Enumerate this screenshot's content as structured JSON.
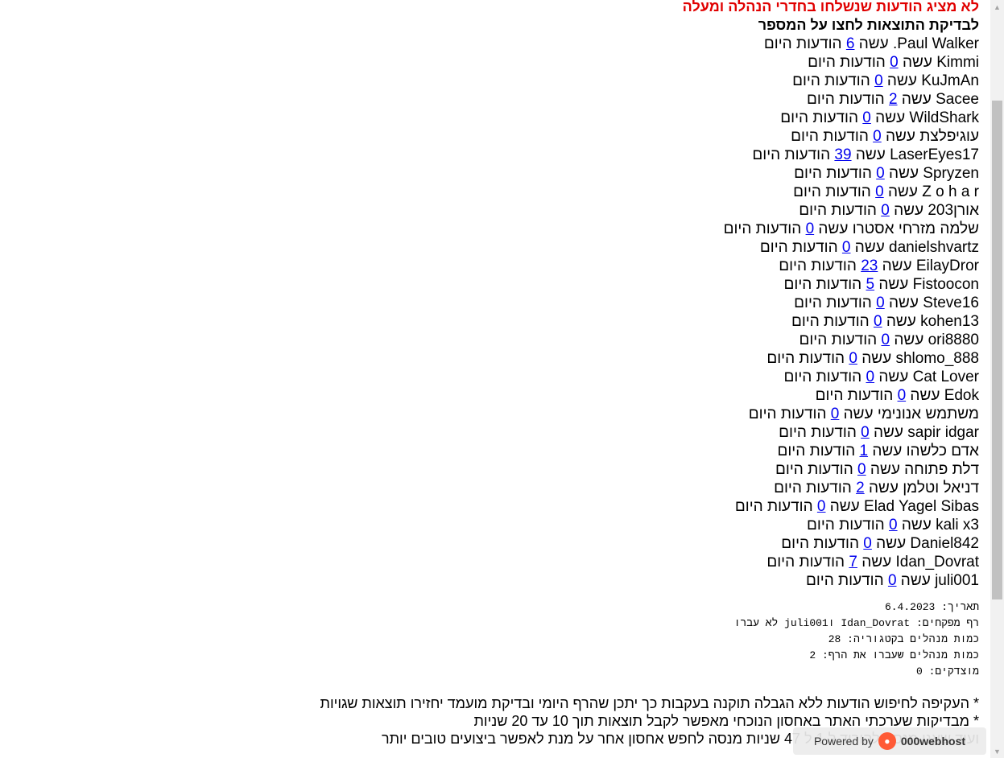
{
  "warning": "לא מציג הודעות שנשלחו בחדרי הנהלה ומעלה",
  "instruction": "לבדיקת התוצאות לחצו על המספר",
  "rows": [
    {
      "name": "Paul Walker.",
      "verb": "עשה",
      "count": "6",
      "suffix": "הודעות היום"
    },
    {
      "name": "Kimmi",
      "verb": "עשה",
      "count": "0",
      "suffix": "הודעות היום"
    },
    {
      "name": "KuJmAn",
      "verb": "עשה",
      "count": "0",
      "suffix": "הודעות היום"
    },
    {
      "name": "Sacee",
      "verb": "עשה",
      "count": "2",
      "suffix": "הודעות היום"
    },
    {
      "name": "WildShark",
      "verb": "עשה",
      "count": "0",
      "suffix": "הודעות היום"
    },
    {
      "name": "עוגיפלצת",
      "verb": "עשה",
      "count": "0",
      "suffix": "הודעות היום"
    },
    {
      "name": "LaserEyes17",
      "verb": "עשה",
      "count": "39",
      "suffix": "הודעות היום"
    },
    {
      "name": "Spryzen",
      "verb": "עשה",
      "count": "0",
      "suffix": "הודעות היום"
    },
    {
      "name": "Z o h a r",
      "verb": "עשה",
      "count": "0",
      "suffix": "הודעות היום"
    },
    {
      "name": "אורן203",
      "verb": "עשה",
      "count": "0",
      "suffix": "הודעות היום"
    },
    {
      "name": "שלמה מזרחי אסטרו",
      "verb": "עשה",
      "count": "0",
      "suffix": "הודעות היום"
    },
    {
      "name": "danielshvartz",
      "verb": "עשה",
      "count": "0",
      "suffix": "הודעות היום"
    },
    {
      "name": "EilayDror",
      "verb": "עשה",
      "count": "23",
      "suffix": "הודעות היום"
    },
    {
      "name": "Fistoocon",
      "verb": "עשה",
      "count": "5",
      "suffix": "הודעות היום"
    },
    {
      "name": "Steve16",
      "verb": "עשה",
      "count": "0",
      "suffix": "הודעות היום"
    },
    {
      "name": "kohen13",
      "verb": "עשה",
      "count": "0",
      "suffix": "הודעות היום"
    },
    {
      "name": "ori8880",
      "verb": "עשה",
      "count": "0",
      "suffix": "הודעות היום"
    },
    {
      "name": "shlomo_888",
      "verb": "עשה",
      "count": "0",
      "suffix": "הודעות היום"
    },
    {
      "name": "Cat Lover",
      "verb": "עשה",
      "count": "0",
      "suffix": "הודעות היום"
    },
    {
      "name": "Edok",
      "verb": "עשה",
      "count": "0",
      "suffix": "הודעות היום"
    },
    {
      "name": "משתמש אנונימי",
      "verb": "עשה",
      "count": "0",
      "suffix": "הודעות היום"
    },
    {
      "name": "sapir idgar",
      "verb": "עשה",
      "count": "0",
      "suffix": "הודעות היום"
    },
    {
      "name": "אדם כלשהו",
      "verb": "עשה",
      "count": "1",
      "suffix": "הודעות היום"
    },
    {
      "name": "דלת פתוחה",
      "verb": "עשה",
      "count": "0",
      "suffix": "הודעות היום"
    },
    {
      "name": "דניאל וטלמן",
      "verb": "עשה",
      "count": "2",
      "suffix": "הודעות היום"
    },
    {
      "name": "Elad Yagel Sibas",
      "verb": "עשה",
      "count": "0",
      "suffix": "הודעות היום"
    },
    {
      "name": "kali x3",
      "verb": "עשה",
      "count": "0",
      "suffix": "הודעות היום"
    },
    {
      "name": "Daniel842",
      "verb": "עשה",
      "count": "0",
      "suffix": "הודעות היום"
    },
    {
      "name": "Idan_Dovrat",
      "verb": "עשה",
      "count": "7",
      "suffix": "הודעות היום"
    },
    {
      "name": "juli001",
      "verb": "עשה",
      "count": "0",
      "suffix": "הודעות היום"
    }
  ],
  "stats": {
    "date_label": "תאריך:",
    "date": "6.4.2023",
    "below_line_label": "רף מפקחים:",
    "below_line_value": "Idan_Dovrat וjuli001 לא עברו",
    "managers_label": "כמות מנהלים בקטגוריה:",
    "managers_value": "28",
    "passed_label": "כמות מנהלים שעברו את הרף:",
    "passed_value": "2",
    "justified_label": "מוצדקים:",
    "justified_value": "0"
  },
  "notes": [
    "* העקיפה לחיפוש הודעות ללא הגבלה תוקנה בעקבות כך יתכן שהרף היומי ובדיקת מועמד יחזירו תוצאות שגויות",
    "* מבדיקות שערכתי האתר באחסון הנוכחי מאפשר לקבל תוצאות תוך 10 עד 20 שניות",
    "ועוד שאני מנסה להוריד ל 1 ל 47 שניות מנסה לחפש אחסון אחר על מנת לאפשר ביצועים טובים יותר"
  ],
  "badge": {
    "prefix": "Powered by",
    "brand": "000webhost",
    "logo_icon": "fire-logo-icon"
  },
  "scrollbar": {
    "up_icon": "scroll-up-arrow-icon",
    "down_icon": "scroll-down-arrow-icon"
  }
}
